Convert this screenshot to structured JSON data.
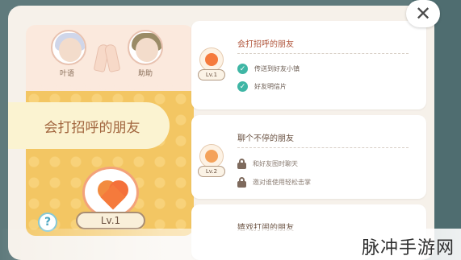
{
  "top_avatars": [
    {
      "name": "叶语",
      "icon": "avatar-girl"
    },
    {
      "name": "助助",
      "icon": "avatar-boy"
    }
  ],
  "main_card": {
    "title": "会打招呼的朋友",
    "level": "Lv.1",
    "help": "?"
  },
  "items": [
    {
      "title": "会打招呼的朋友",
      "level": "Lv.1",
      "state": "active",
      "rows": [
        {
          "text": "传送到好友小镇",
          "icon": "check-icon"
        },
        {
          "text": "好友明信片",
          "icon": "check-icon"
        }
      ]
    },
    {
      "title": "聊个不停的朋友",
      "level": "Lv.2",
      "state": "locked",
      "rows": [
        {
          "text": "和好友图时聊天",
          "icon": "lock-icon"
        },
        {
          "text": "邀对谁使用轻松击掌",
          "icon": "lock-icon"
        }
      ]
    },
    {
      "title": "嬉戏打闹的朋友",
      "level": "",
      "state": "locked",
      "rows": []
    }
  ],
  "close": "✕",
  "watermark": "脉冲手游网",
  "colors": {
    "accent_active": "#b1563c",
    "check": "#3fb6a5",
    "card_yellow": "#f3c663",
    "panel": "#f6f1ea"
  }
}
